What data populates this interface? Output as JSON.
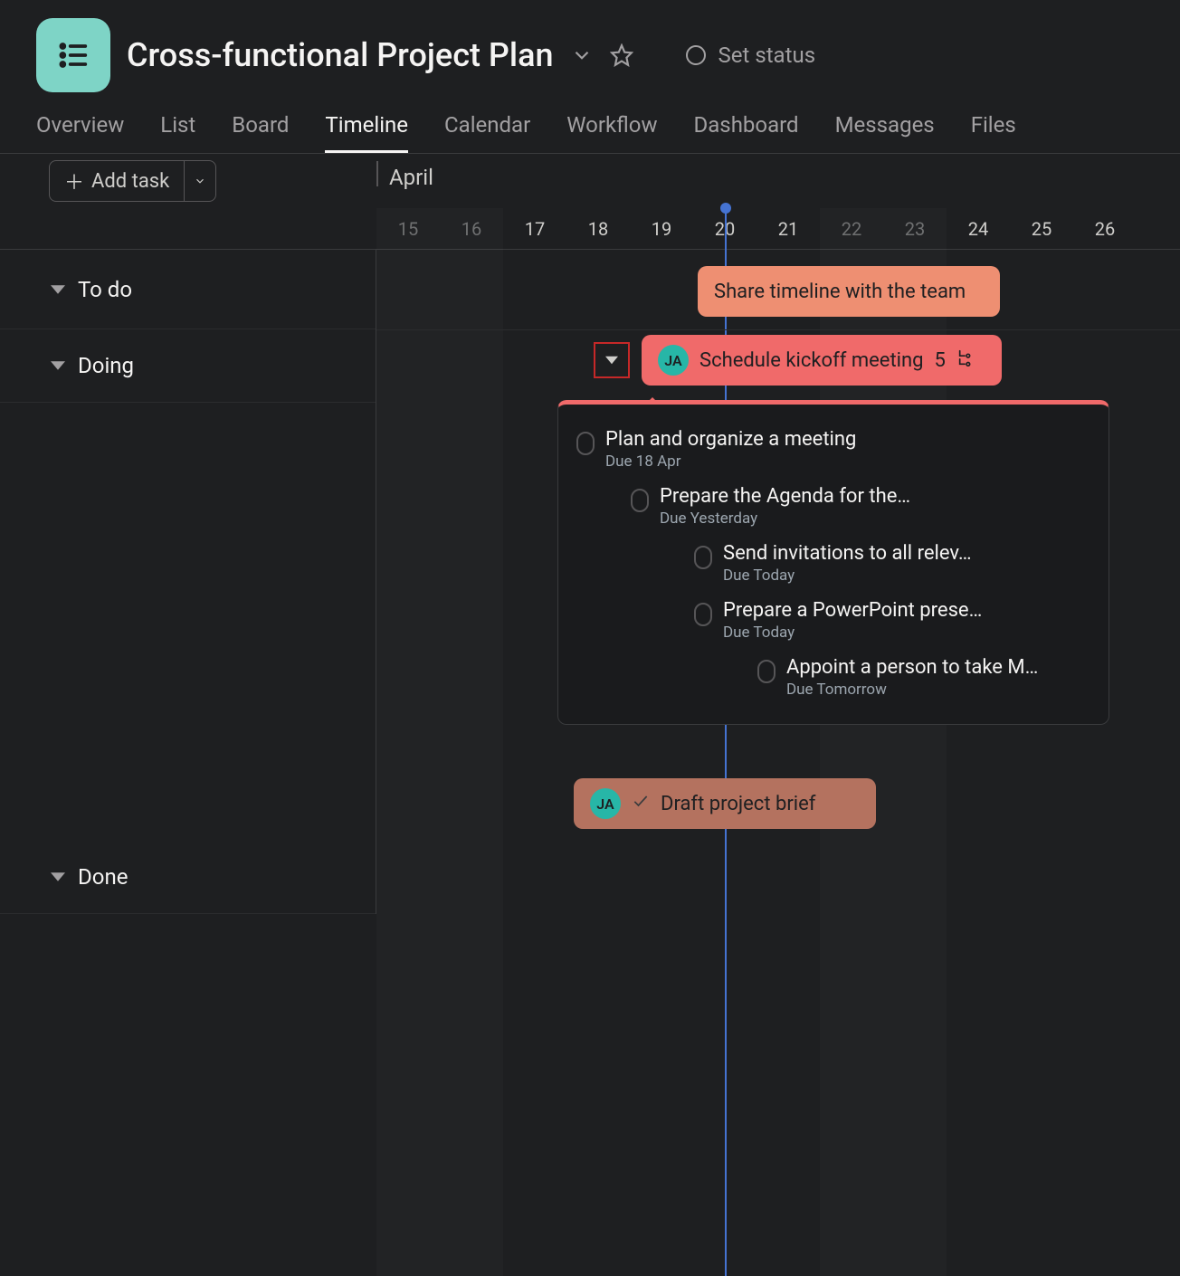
{
  "project": {
    "title": "Cross-functional Project Plan",
    "status_label": "Set status"
  },
  "tabs": [
    {
      "label": "Overview",
      "active": false
    },
    {
      "label": "List",
      "active": false
    },
    {
      "label": "Board",
      "active": false
    },
    {
      "label": "Timeline",
      "active": true
    },
    {
      "label": "Calendar",
      "active": false
    },
    {
      "label": "Workflow",
      "active": false
    },
    {
      "label": "Dashboard",
      "active": false
    },
    {
      "label": "Messages",
      "active": false
    },
    {
      "label": "Files",
      "active": false
    }
  ],
  "toolbar": {
    "add_task_label": "Add task"
  },
  "timeline": {
    "month_label": "April",
    "dates": [
      "15",
      "16",
      "17",
      "18",
      "19",
      "20",
      "21",
      "22",
      "23",
      "24",
      "25",
      "26"
    ],
    "weekend_dim_indexes": [
      0,
      1,
      7,
      8
    ],
    "today_index": 5
  },
  "sections": {
    "todo": "To do",
    "doing": "Doing",
    "done": "Done"
  },
  "tasks": {
    "share": {
      "label": "Share timeline with the team"
    },
    "kickoff": {
      "label": "Schedule kickoff meeting",
      "assignee": "JA",
      "subtask_count": "5"
    },
    "draft": {
      "label": "Draft project brief",
      "assignee": "JA"
    }
  },
  "subtasks": [
    {
      "title": "Plan and organize a meeting",
      "due": "Due 18 Apr",
      "indent": 0
    },
    {
      "title": "Prepare the Agenda for the…",
      "due": "Due Yesterday",
      "indent": 1
    },
    {
      "title": "Send invitations to all relev…",
      "due": "Due Today",
      "indent": 2
    },
    {
      "title": "Prepare a PowerPoint prese…",
      "due": "Due Today",
      "indent": 2
    },
    {
      "title": "Appoint a person to take M…",
      "due": "Due Tomorrow",
      "indent": 3
    }
  ]
}
